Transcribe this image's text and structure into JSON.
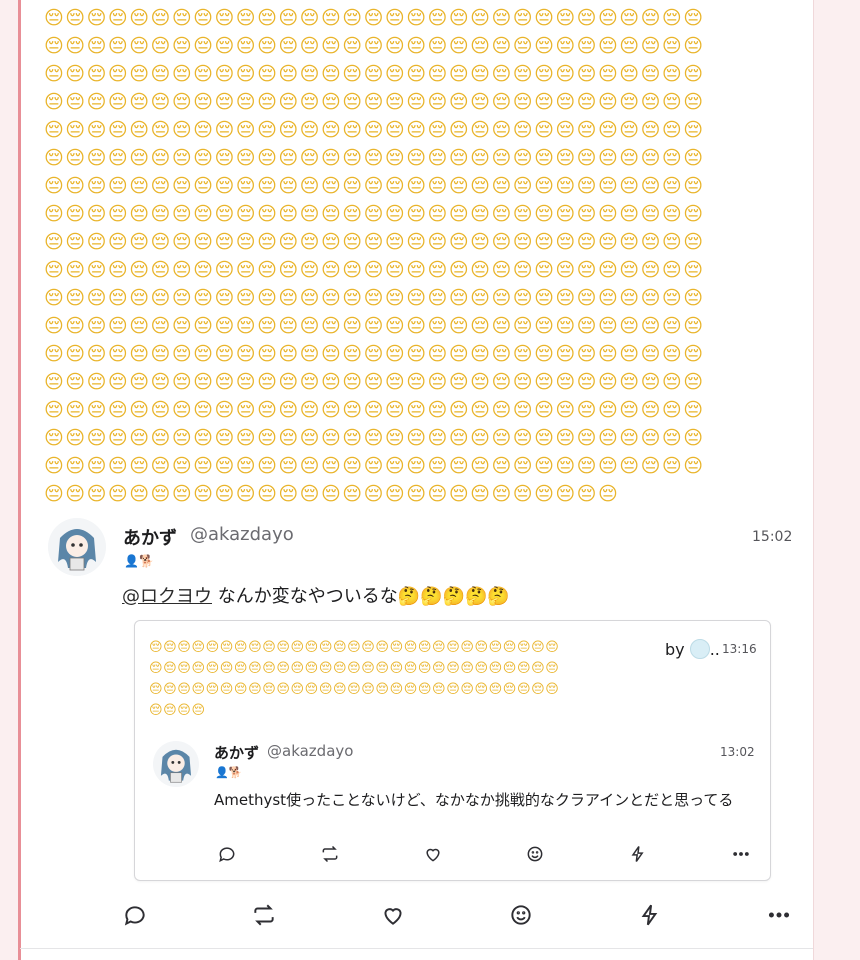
{
  "top_note": {
    "emoji_char": "😔",
    "full_rows": 17,
    "per_row": 31,
    "last_row_count": 27
  },
  "reply_note": {
    "display_name": "あかず",
    "handle": "@akazdayo",
    "time": "15:02",
    "badges": "👤🐕",
    "mention": "@ロクヨウ",
    "text": " なんか変なやついるな",
    "trailing_emoji": "🤔🤔🤔🤔🤔"
  },
  "quoted": {
    "emoji_char": "😔",
    "rows": [
      29,
      29,
      29,
      4
    ],
    "by_label": "by",
    "by_suffix": "..",
    "time": "13:16",
    "inner_note": {
      "display_name": "あかず",
      "handle": "@akazdayo",
      "time": "13:02",
      "badges": "👤🐕",
      "text": "Amethyst使ったことないけど、なかなか挑戦的なクラアインとだと思ってる"
    }
  },
  "actions": [
    "reply-icon",
    "renote-icon",
    "like-icon",
    "reaction-icon",
    "boost-icon",
    "more-icon"
  ],
  "colors": {
    "accent_line": "#e88f97",
    "page_bg": "#fbeff0",
    "emoji": "#e9b42a"
  }
}
